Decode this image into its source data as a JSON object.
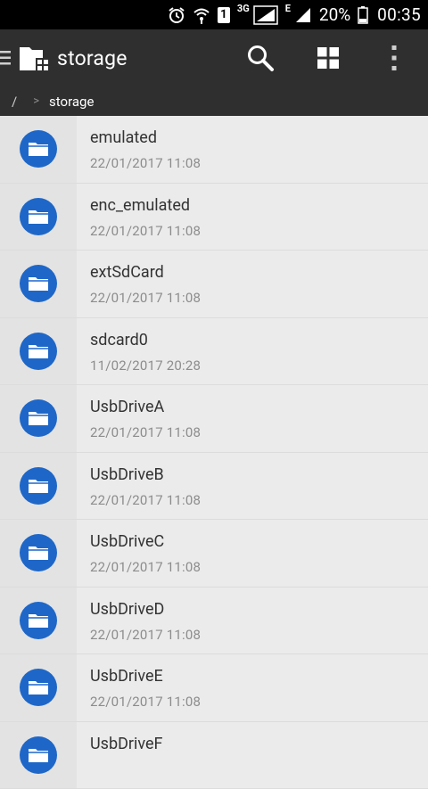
{
  "status_bar": {
    "battery": "20%",
    "time": "00:35",
    "network_3g": "3G",
    "network_e": "E",
    "sim": "1"
  },
  "app_bar": {
    "title": "storage"
  },
  "breadcrumb": {
    "root": "/",
    "separator": ">",
    "current": "storage"
  },
  "files": [
    {
      "name": "emulated",
      "date": "22/01/2017  11:08"
    },
    {
      "name": "enc_emulated",
      "date": "22/01/2017  11:08"
    },
    {
      "name": "extSdCard",
      "date": "22/01/2017  11:08"
    },
    {
      "name": "sdcard0",
      "date": "11/02/2017  20:28"
    },
    {
      "name": "UsbDriveA",
      "date": "22/01/2017  11:08"
    },
    {
      "name": "UsbDriveB",
      "date": "22/01/2017  11:08"
    },
    {
      "name": "UsbDriveC",
      "date": "22/01/2017  11:08"
    },
    {
      "name": "UsbDriveD",
      "date": "22/01/2017  11:08"
    },
    {
      "name": "UsbDriveE",
      "date": "22/01/2017  11:08"
    },
    {
      "name": "UsbDriveF",
      "date": ""
    }
  ],
  "colors": {
    "accent": "#1e67c8",
    "toolbar": "#2f2f2f",
    "status_bar": "#000000",
    "list_background": "#ebebeb"
  }
}
